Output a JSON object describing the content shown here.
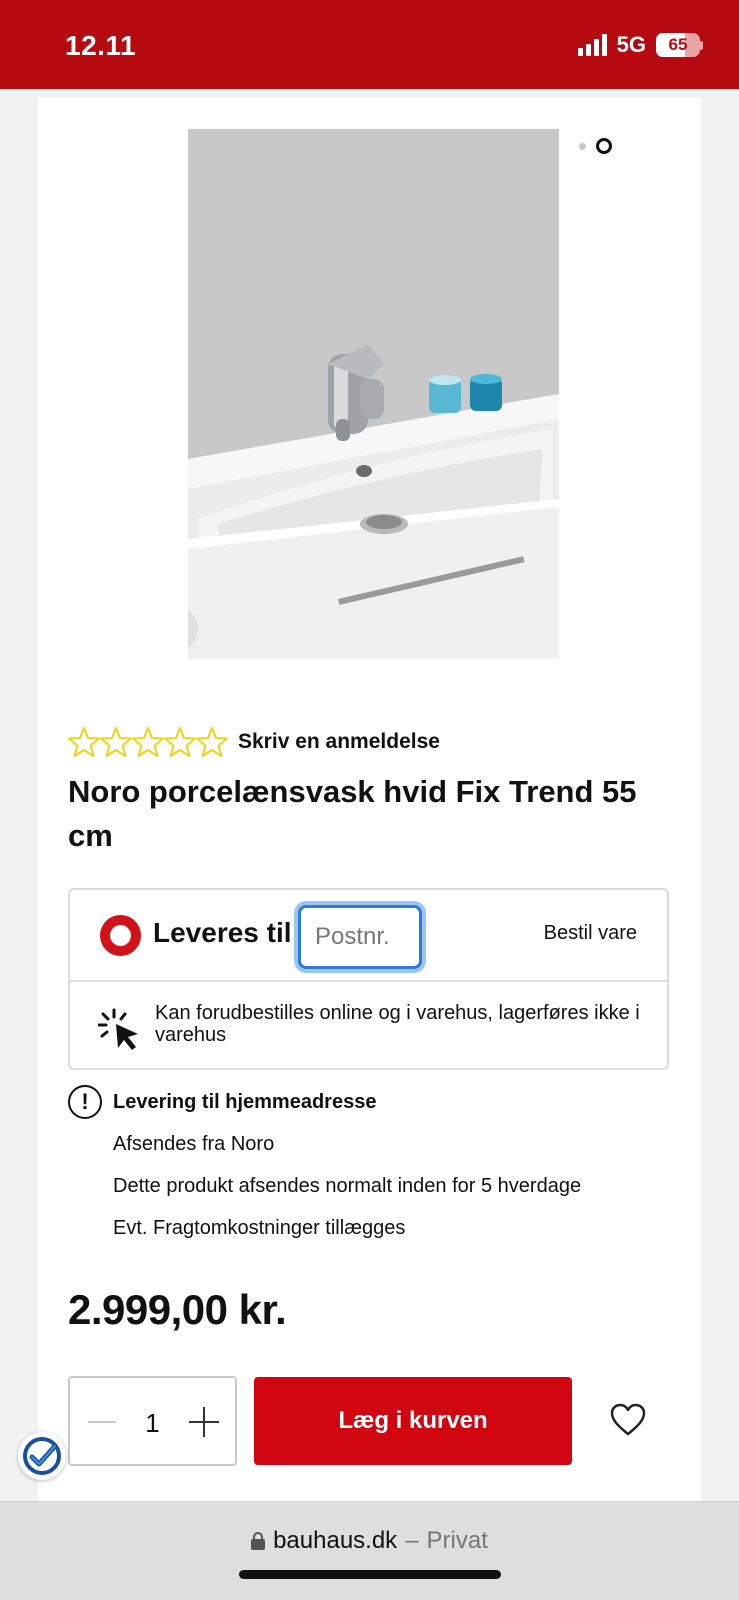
{
  "status_bar": {
    "time": "12.11",
    "network": "5G",
    "battery": "65",
    "battery_level": 0.65
  },
  "gallery": {
    "image_alt": "Noro porcelænsvask hvid Fix Trend 55 cm",
    "slide_count": 2,
    "active_slide": 2
  },
  "rating": {
    "stars": 0,
    "max_stars": 5,
    "review_link": "Skriv en anmeldelse"
  },
  "product": {
    "title": "Noro porcelænsvask hvid Fix Trend 55 cm",
    "price": "2.999,00 kr."
  },
  "delivery": {
    "label": "Leveres til:",
    "postnr_placeholder": "Postnr.",
    "postnr_value": "",
    "order_label": "Bestil vare",
    "preorder_note": "Kan forudbestilles online og i varehus, lagerføres ikke i varehus"
  },
  "home_delivery": {
    "title": "Levering til hjemmeadresse",
    "lines": [
      "Afsendes fra Noro",
      "Dette produkt afsendes normalt inden for 5 hverdage",
      "Evt. Fragtomkostninger tillægges"
    ]
  },
  "cart": {
    "quantity": "1",
    "add_label": "Læg i kurven"
  },
  "browser": {
    "domain": "bauhaus.dk",
    "separator": "–",
    "mode": "Privat"
  },
  "colors": {
    "brand_red": "#d0050f",
    "status_bar": "#b50a0f",
    "star_outline": "#f2d21b",
    "focus_blue": "#2e7bd4"
  }
}
